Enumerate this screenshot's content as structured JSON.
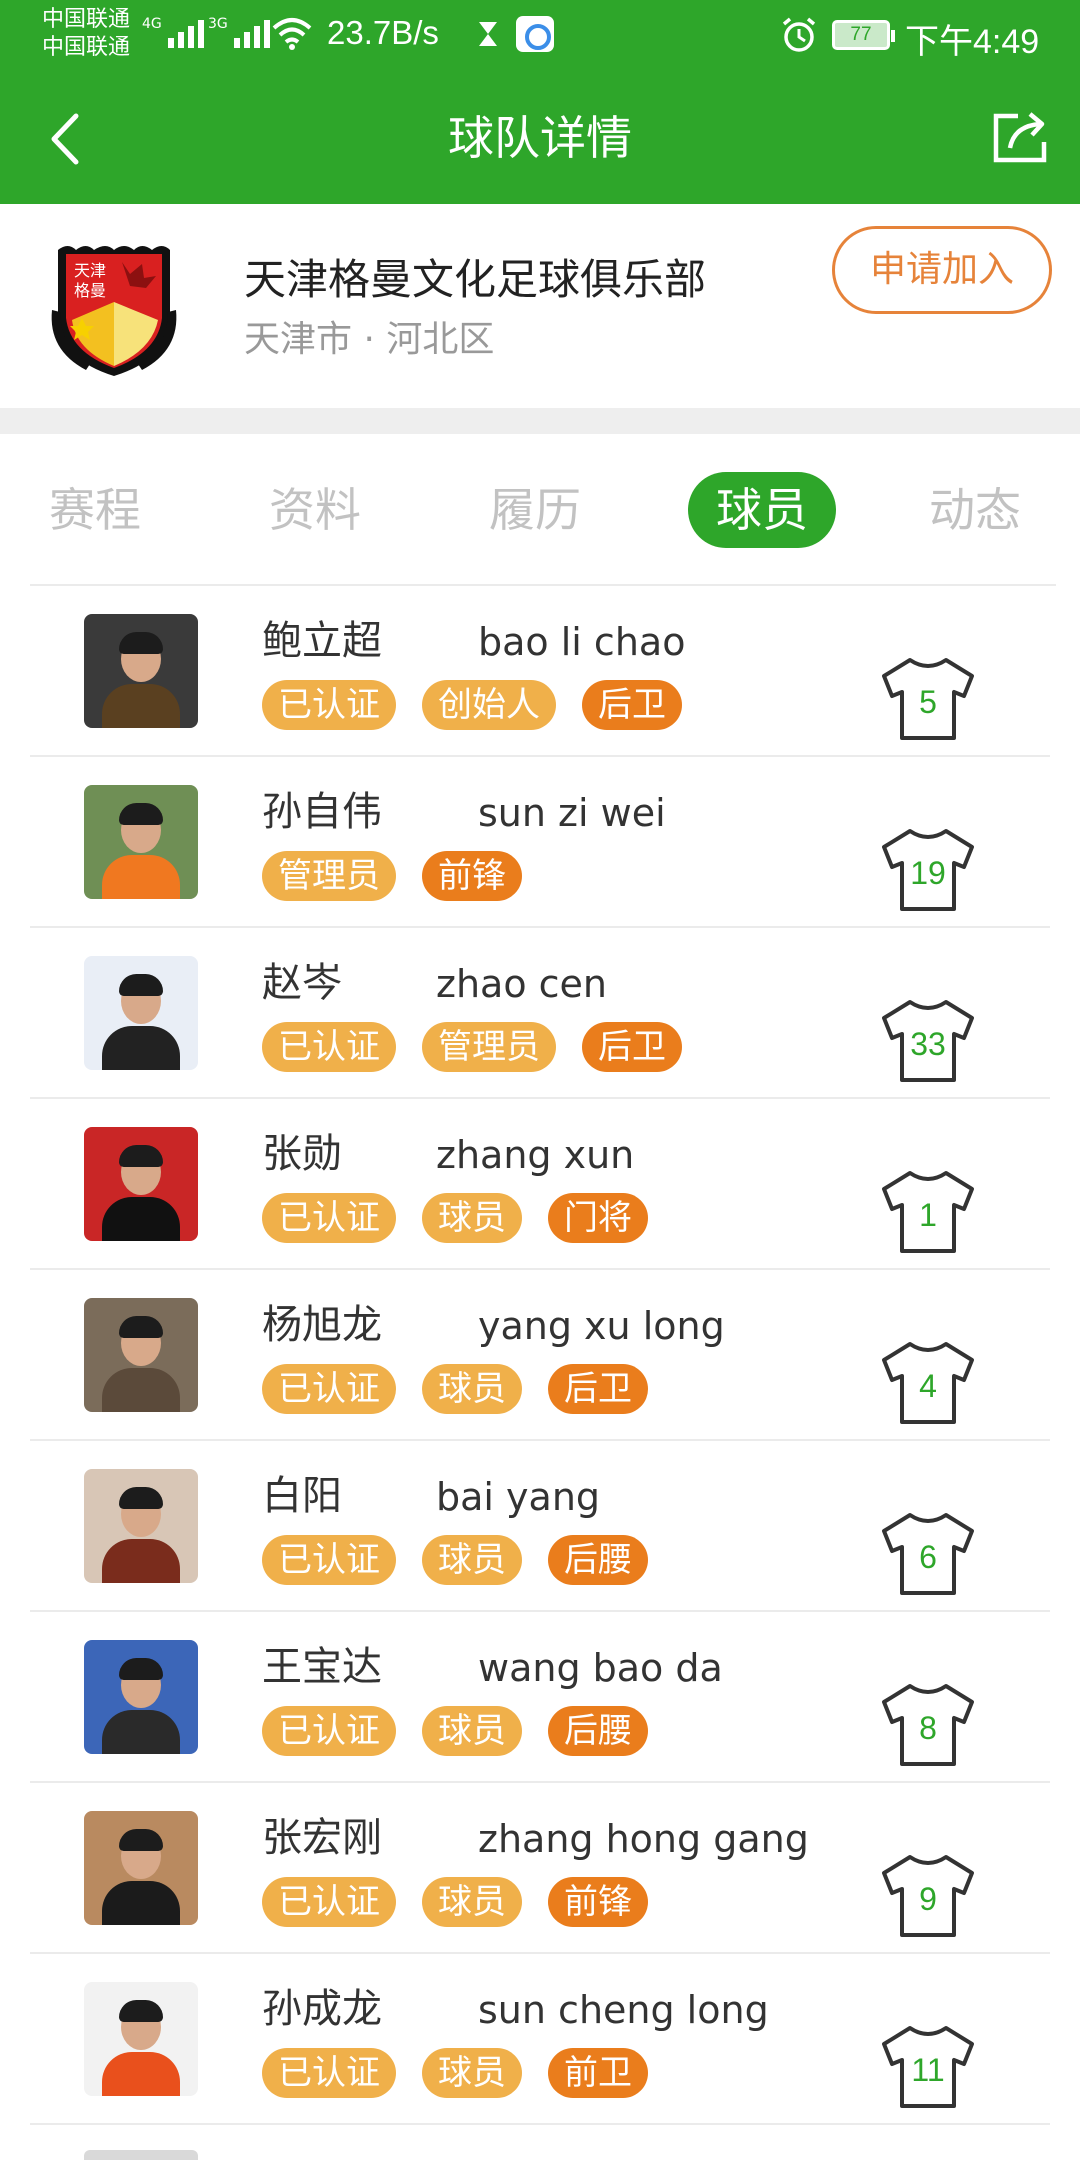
{
  "status_bar": {
    "carrier_1": "中国联通",
    "carrier_2": "中国联通",
    "net_1": "4G",
    "net_2": "3G",
    "speed": "23.7B/s",
    "battery": "77",
    "time": "下午4:49"
  },
  "nav": {
    "title": "球队详情",
    "back_icon": "chevron-left-icon",
    "share_icon": "share-icon"
  },
  "team": {
    "name": "天津格曼文化足球俱乐部",
    "location": "天津市 · 河北区",
    "join_label": "申请加入",
    "logo_text": "天津格曼",
    "accent": "#e6833a"
  },
  "colors": {
    "brand_green": "#2ea62a",
    "badge_light": "#f0b04a",
    "badge_dark": "#ea7d1c"
  },
  "tabs": [
    {
      "label": "赛程",
      "active": false
    },
    {
      "label": "资料",
      "active": false
    },
    {
      "label": "履历",
      "active": false
    },
    {
      "label": "球员",
      "active": true
    },
    {
      "label": "动态",
      "active": false
    }
  ],
  "players": [
    {
      "cn": "鲍立超",
      "pinyin": "bao li chao",
      "tags": [
        "已认证",
        "创始人",
        "后卫"
      ],
      "number": "5"
    },
    {
      "cn": "孙自伟",
      "pinyin": "sun zi wei",
      "tags": [
        "管理员",
        "前锋"
      ],
      "number": "19"
    },
    {
      "cn": "赵岑",
      "pinyin": "zhao cen",
      "tags": [
        "已认证",
        "管理员",
        "后卫"
      ],
      "number": "33"
    },
    {
      "cn": "张勋",
      "pinyin": "zhang xun",
      "tags": [
        "已认证",
        "球员",
        "门将"
      ],
      "number": "1"
    },
    {
      "cn": "杨旭龙",
      "pinyin": "yang xu long",
      "tags": [
        "已认证",
        "球员",
        "后卫"
      ],
      "number": "4"
    },
    {
      "cn": "白阳",
      "pinyin": "bai yang",
      "tags": [
        "已认证",
        "球员",
        "后腰"
      ],
      "number": "6"
    },
    {
      "cn": "王宝达",
      "pinyin": "wang bao da",
      "tags": [
        "已认证",
        "球员",
        "后腰"
      ],
      "number": "8"
    },
    {
      "cn": "张宏刚",
      "pinyin": "zhang hong gang",
      "tags": [
        "已认证",
        "球员",
        "前锋"
      ],
      "number": "9"
    },
    {
      "cn": "孙成龙",
      "pinyin": "sun cheng long",
      "tags": [
        "已认证",
        "球员",
        "前卫"
      ],
      "number": "11"
    }
  ]
}
